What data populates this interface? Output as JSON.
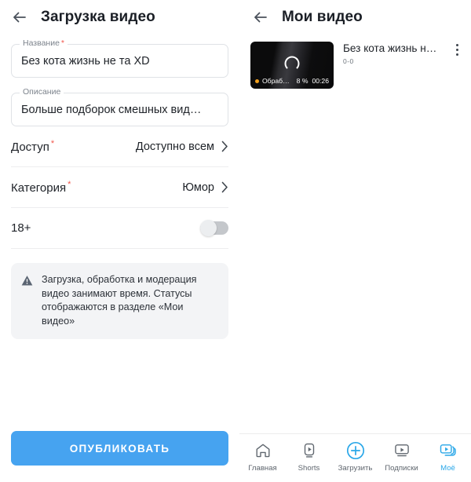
{
  "upload_screen": {
    "back_icon": "arrow-left-icon",
    "title": "Загрузка видео",
    "title_field": {
      "label": "Название",
      "required_marker": "*",
      "value": "Без кота жизнь не та XD"
    },
    "description_field": {
      "label": "Описание",
      "value": "Больше подборок смешных вид…"
    },
    "access_row": {
      "label": "Доступ",
      "required_marker": "*",
      "value": "Доступно всем",
      "chevron": "chevron-right-icon"
    },
    "category_row": {
      "label": "Категория",
      "required_marker": "*",
      "value": "Юмор",
      "chevron": "chevron-right-icon"
    },
    "age_row": {
      "label": "18+",
      "toggle_state": "off"
    },
    "notice": {
      "icon": "warning-triangle-icon",
      "text": "Загрузка, обработка и модерация видео занимают время. Статусы отображаются в разделе «Мои видео»"
    },
    "publish_button": "ОПУБЛИКОВАТЬ"
  },
  "my_videos_screen": {
    "back_icon": "arrow-left-icon",
    "title": "Мои видео",
    "video": {
      "title": "Без кота жизнь н…",
      "subtitle": "0-0",
      "status_label": "Обработ…",
      "progress_percent": "8 %",
      "duration": "00:26",
      "status_dot_color": "#f2a01d",
      "menu_icon": "kebab-menu-icon",
      "spinner": "loading-spinner-icon"
    },
    "bottom_nav": {
      "items": [
        {
          "label": "Главная",
          "icon": "home-icon",
          "active": false
        },
        {
          "label": "Shorts",
          "icon": "shorts-icon",
          "active": false
        },
        {
          "label": "Загрузить",
          "icon": "plus-circle-icon",
          "active": false
        },
        {
          "label": "Подписки",
          "icon": "subscriptions-icon",
          "active": false
        },
        {
          "label": "Моё",
          "icon": "my-videos-icon",
          "active": true
        }
      ]
    }
  },
  "colors": {
    "accent_blue": "#46a3f0",
    "nav_active": "#2aa7e8",
    "required_red": "#f2574c",
    "status_orange": "#f2a01d"
  }
}
